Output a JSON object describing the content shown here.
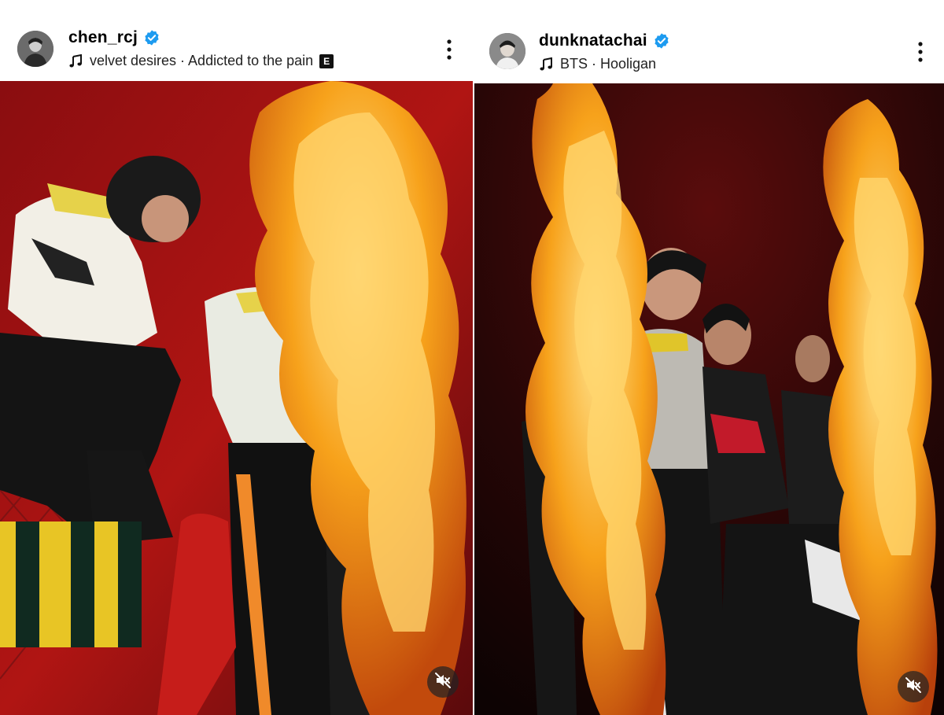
{
  "posts": [
    {
      "username": "chen_rcj",
      "verified": true,
      "audio_text": "velvet desires · Addicted to the pain",
      "explicit_label": "E",
      "avatar_icon": "profile-photo",
      "media_description_icon": "stage-photo",
      "mute_icon": "speaker-muted-icon"
    },
    {
      "username": "dunknatachai",
      "verified": true,
      "audio_text": "BTS · Hooligan",
      "avatar_icon": "profile-photo",
      "media_description_icon": "stage-photo",
      "mute_icon": "speaker-muted-icon"
    }
  ],
  "colors": {
    "verified_blue": "#1d9bf0",
    "flame_orange": "#f7a21b",
    "stage_red": "#b01513"
  }
}
